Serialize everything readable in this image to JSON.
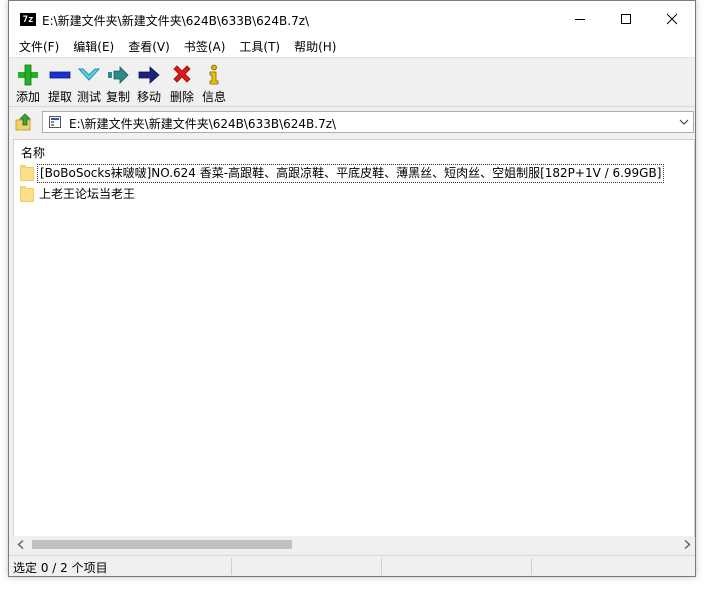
{
  "window": {
    "title": "E:\\新建文件夹\\新建文件夹\\624B\\633B\\624B.7z\\",
    "app_icon_text": "7z",
    "controls": [
      "minimize-icon",
      "maximize-icon",
      "close-icon"
    ]
  },
  "menu": {
    "items": [
      "文件(F)",
      "编辑(E)",
      "查看(V)",
      "书签(A)",
      "工具(T)",
      "帮助(H)"
    ]
  },
  "toolbar": {
    "tools": [
      {
        "label": "添加",
        "icon": "add-icon",
        "color": "#22b026"
      },
      {
        "label": "提取",
        "icon": "extract-icon",
        "color": "#1b2fd6"
      },
      {
        "label": "测试",
        "icon": "test-icon",
        "color": "#29a7c7"
      },
      {
        "label": "复制",
        "icon": "copy-icon",
        "color": "#2b8c8c"
      },
      {
        "label": "移动",
        "icon": "move-icon",
        "color": "#1a237e"
      },
      {
        "label": "删除",
        "icon": "delete-icon",
        "color": "#e01818"
      },
      {
        "label": "信息",
        "icon": "info-icon",
        "color": "#d9b400"
      }
    ]
  },
  "address": {
    "path": "E:\\新建文件夹\\新建文件夹\\624B\\633B\\624B.7z\\"
  },
  "list": {
    "column_name": "名称",
    "rows": [
      {
        "name": "[BoBoSocks袜啵啵]NO.624 香菜-高跟鞋、高跟凉鞋、平底皮鞋、薄黑丝、短肉丝、空姐制服[182P+1V / 6.99GB]",
        "selected": true
      },
      {
        "name": "上老王论坛当老王",
        "selected": false
      }
    ]
  },
  "status": {
    "text": "选定 0 / 2 个项目"
  }
}
